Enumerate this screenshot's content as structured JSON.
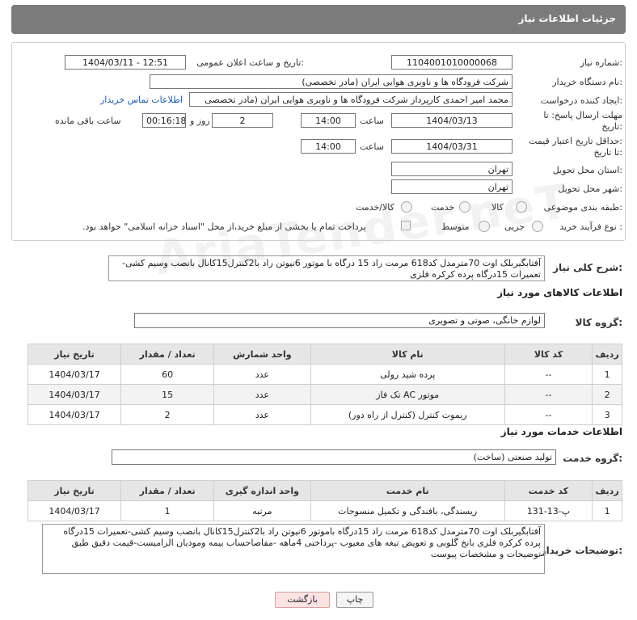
{
  "header": {
    "title": "جزئیات اطلاعات نیاز"
  },
  "form": {
    "need_number_label": "شماره نیاز:",
    "need_number": "1104001010000068",
    "announce_label": "تاریخ و ساعت اعلان عمومی:",
    "announce_value": "1404/03/11 - 12:51",
    "buyer_org_label": "نام دستگاه خریدار:",
    "buyer_org": "شرکت فرودگاه ها و ناوبری هوایی ایران (مادر تخصصی)",
    "creator_label": "ایجاد کننده درخواست:",
    "creator": "محمد امیر احمدی کارپرداز شرکت فرودگاه ها و ناوبری هوایی ایران (مادر تخصصی",
    "contact_link": "اطلاعات تماس خریدار",
    "deadline_label_1": "مهلت ارسال پاسخ: تا",
    "deadline_label_2": "تاریخ:",
    "deadline_date": "1404/03/13",
    "time_label": "ساعت",
    "deadline_time": "14:00",
    "days_value": "2",
    "days_label": "روز و",
    "remaining_time": "00:16:18",
    "remaining_label": "ساعت باقی مانده",
    "validity_label_1": "حداقل تاریخ اعتبار قیمت:",
    "validity_label_2": "تا تاریخ:",
    "validity_date": "1404/03/31",
    "validity_time": "14:00",
    "province_label": "استان محل تحویل:",
    "province": "تهران",
    "city_label": "شهر محل تحویل:",
    "city": "تهران",
    "category_label": "طبقه بندی موضوعی:",
    "category_options": [
      "کالا",
      "خدمت",
      "کالا/خدمت"
    ],
    "process_label": "نوع فرآیند خرید :",
    "process_options": [
      "جزیی",
      "متوسط"
    ],
    "payment_note": "پرداخت تمام یا بخشی از مبلغ خرید،از محل \"اسناد خزانه اسلامی\" خواهد بود."
  },
  "summary": {
    "label": "شرح کلی نیاز:",
    "text": "آفتابگیربلک اوت 70مترمدل کد618 مرمت راد 15 درگاه با موتور 6نیوتن راد با2کنترل15کانال بانصب وسیم کشی-تعمیرات 15درگاه پرده کرکره فلزی"
  },
  "goods": {
    "section_title": "اطلاعات کالاهای مورد نیاز",
    "group_label": "گروه کالا:",
    "group_value": "لوازم خانگی، صوتی و تصویری",
    "columns": [
      "ردیف",
      "کد کالا",
      "نام کالا",
      "واحد شمارش",
      "تعداد / مقدار",
      "تاریخ نیاز"
    ],
    "rows": [
      [
        "1",
        "--",
        "پرده شید رولی",
        "عدد",
        "60",
        "1404/03/17"
      ],
      [
        "2",
        "--",
        "موتور AC تک فاز",
        "عدد",
        "15",
        "1404/03/17"
      ],
      [
        "3",
        "--",
        "ریموت کنترل (کنترل از راه دور)",
        "عدد",
        "2",
        "1404/03/17"
      ]
    ]
  },
  "services": {
    "section_title": "اطلاعات خدمات مورد نیاز",
    "group_label": "گروه خدمت:",
    "group_value": "تولید صنعتی (ساخت)",
    "columns": [
      "ردیف",
      "کد خدمت",
      "نام خدمت",
      "واحد اندازه گیری",
      "تعداد / مقدار",
      "تاریخ نیاز"
    ],
    "rows": [
      [
        "1",
        "پ-13-131",
        "ریسندگی، بافندگی و تکمیل منسوجات",
        "مرتبه",
        "1",
        "1404/03/17"
      ]
    ]
  },
  "buyer_notes": {
    "label": "توضیحات خریدار:",
    "text": "آفتابگیربلک اوت 70مترمدل کد618 مرمت راد 15درگاه باموتور 6نیوتن راد با2کنترل15کانال بانصب وسیم کشی-تعمیرات 15درگاه پرده کرکره فلزی بانخ گلوبی و تعویض تیغه های معیوب -پرداختی 4ماهه -مفاصاحساب بیمه وموديان الزامیست-قیمت دقیق طبق توضیحات و مشخصات پیوست"
  },
  "buttons": {
    "print": "چاپ",
    "back": "بازگشت"
  },
  "watermark": "AriaTender.neT"
}
